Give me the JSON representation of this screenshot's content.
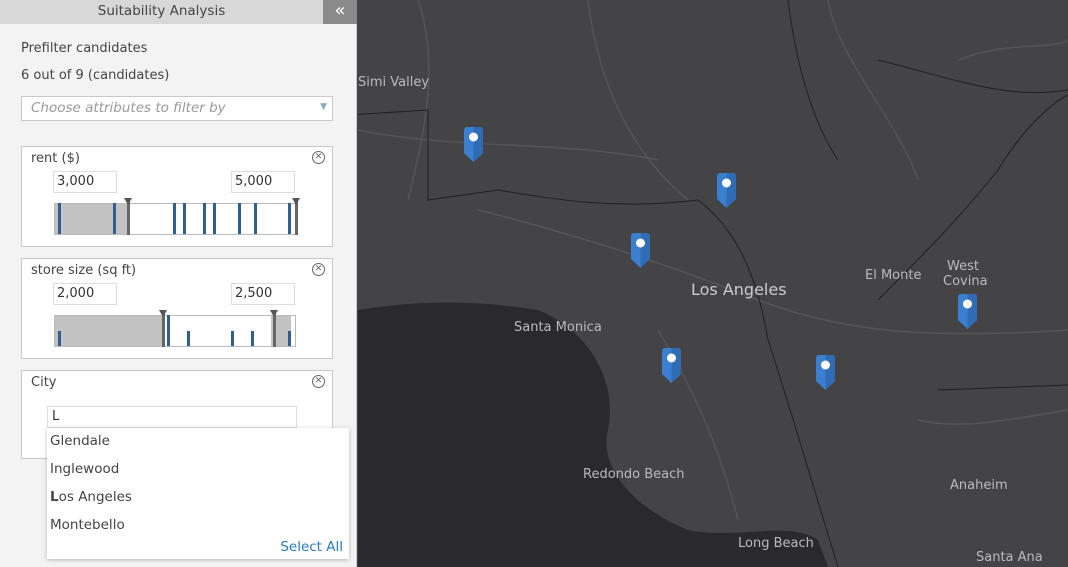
{
  "panel": {
    "title": "Suitability Analysis",
    "collapse_icon": "double-chevron-left",
    "prefilter_label": "Prefilter candidates",
    "count_text": "6 out of 9 (candidates)",
    "attr_placeholder": "Choose attributes to filter by",
    "filters": [
      {
        "title": "rent ($)",
        "min": "3,000",
        "max": "5,000"
      },
      {
        "title": "store size (sq ft)",
        "min": "2,000",
        "max": "2,500"
      },
      {
        "title": "City",
        "query": "L"
      }
    ],
    "city_options": [
      "Glendale",
      "Inglewood",
      "Los Angeles",
      "Montebello"
    ],
    "select_all": "Select All"
  },
  "map": {
    "labels": [
      "Simi Valley",
      "Los Angeles",
      "Santa Monica",
      "El Monte",
      "West Covina",
      "Redondo Beach",
      "Anaheim",
      "Long Beach",
      "Santa Ana"
    ],
    "pin_color": "#3b7fd0",
    "candidate_count": 6
  }
}
